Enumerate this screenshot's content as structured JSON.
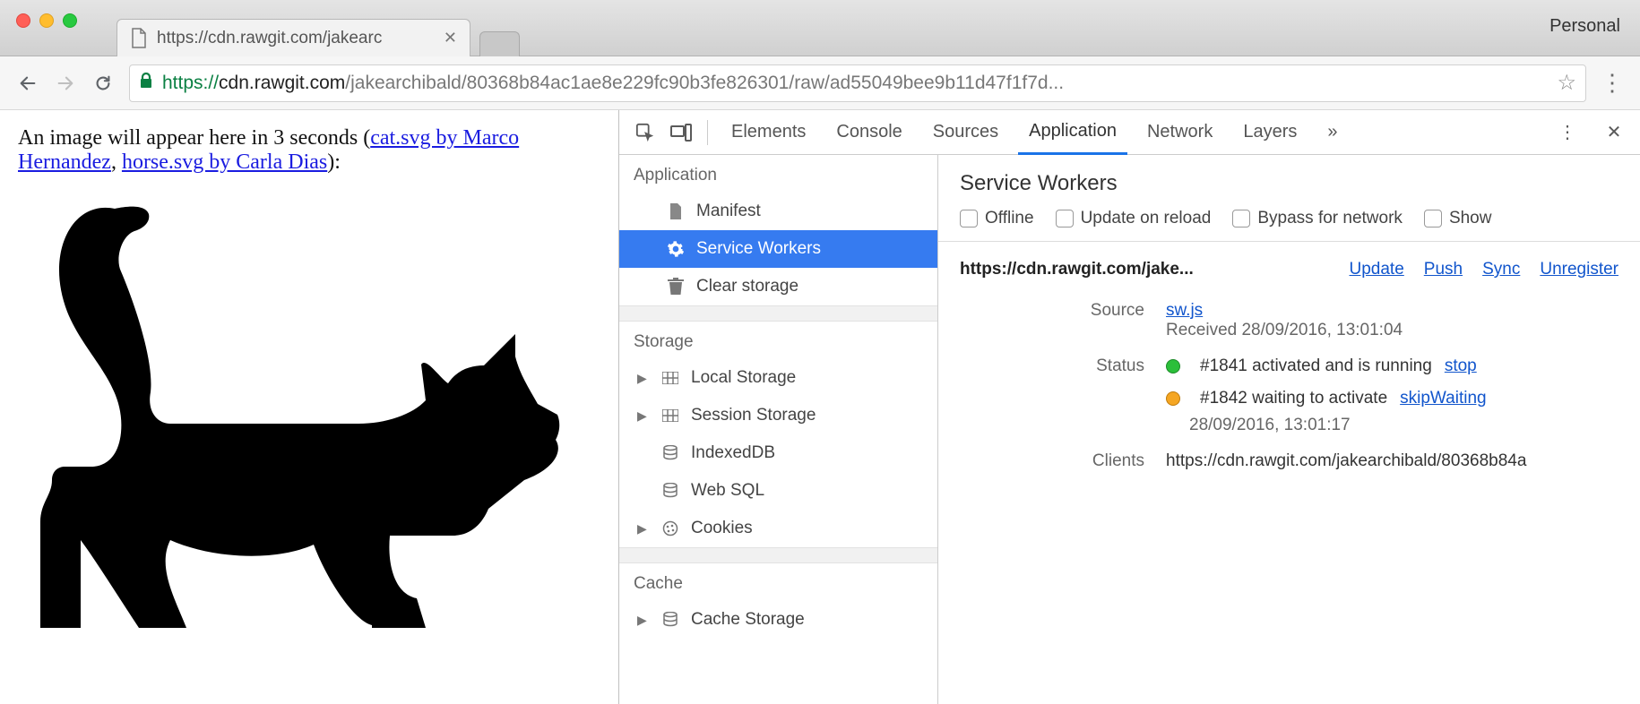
{
  "window": {
    "profile": "Personal"
  },
  "tab": {
    "title": "https://cdn.rawgit.com/jakearc"
  },
  "address": {
    "scheme": "https",
    "host_prefix": "://",
    "host": "cdn.rawgit.com",
    "path": "/jakearchibald/80368b84ac1ae8e229fc90b3fe826301/raw/ad55049bee9b11d47f1f7d..."
  },
  "page": {
    "prefix": "An image will appear here in 3 seconds (",
    "link1": "cat.svg by Marco Hernandez",
    "sep1": ", ",
    "link2": "horse.svg by Carla Dias",
    "suffix": "):"
  },
  "devtools_tabs": {
    "items": [
      "Elements",
      "Console",
      "Sources",
      "Application",
      "Network",
      "Layers"
    ],
    "active_index": 3,
    "overflow": "»"
  },
  "sidebar": {
    "groups": [
      {
        "label": "Application",
        "items": [
          {
            "label": "Manifest",
            "icon": "file-icon",
            "caret": false
          },
          {
            "label": "Service Workers",
            "icon": "gear-icon",
            "caret": false,
            "selected": true
          },
          {
            "label": "Clear storage",
            "icon": "trash-icon",
            "caret": false
          }
        ]
      },
      {
        "label": "Storage",
        "items": [
          {
            "label": "Local Storage",
            "icon": "grid-icon",
            "caret": true
          },
          {
            "label": "Session Storage",
            "icon": "grid-icon",
            "caret": true
          },
          {
            "label": "IndexedDB",
            "icon": "database-icon",
            "caret": false
          },
          {
            "label": "Web SQL",
            "icon": "database-icon",
            "caret": false
          },
          {
            "label": "Cookies",
            "icon": "cookie-icon",
            "caret": true
          }
        ]
      },
      {
        "label": "Cache",
        "items": [
          {
            "label": "Cache Storage",
            "icon": "database-icon",
            "caret": true
          }
        ]
      }
    ]
  },
  "panel": {
    "title": "Service Workers",
    "options": [
      "Offline",
      "Update on reload",
      "Bypass for network",
      "Show"
    ],
    "origin": "https://cdn.rawgit.com/jake...",
    "actions": [
      "Update",
      "Push",
      "Sync",
      "Unregister"
    ],
    "source": {
      "label": "Source",
      "file": "sw.js",
      "received": "Received 28/09/2016, 13:01:04"
    },
    "status": {
      "label": "Status",
      "activated": {
        "text": "#1841 activated and is running",
        "action": "stop"
      },
      "waiting": {
        "text": "#1842 waiting to activate",
        "action": "skipWaiting",
        "time": "28/09/2016, 13:01:17"
      }
    },
    "clients": {
      "label": "Clients",
      "value": "https://cdn.rawgit.com/jakearchibald/80368b84a"
    }
  }
}
